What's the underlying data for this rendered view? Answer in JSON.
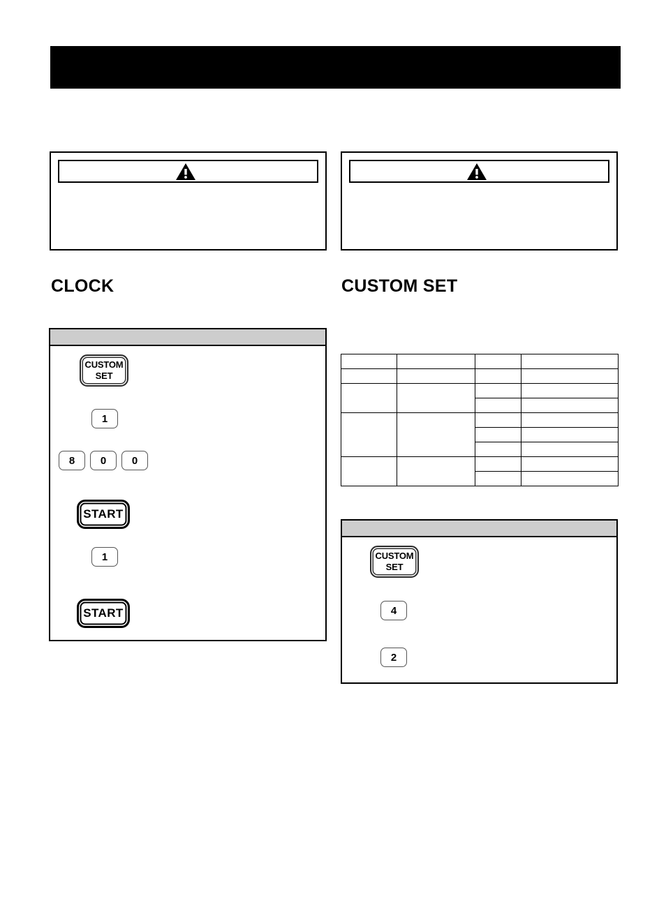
{
  "header": {
    "title": ""
  },
  "warnings": [
    {
      "id": "warning-left",
      "icon": "warning-triangle-icon",
      "label": "",
      "body": ""
    },
    {
      "id": "warning-right",
      "icon": "warning-triangle-icon",
      "label": "",
      "body": ""
    }
  ],
  "sections": {
    "clock": {
      "heading": "CLOCK",
      "panel": {
        "header": "",
        "steps": [
          {
            "keys": [
              {
                "type": "wide",
                "line1": "CUSTOM",
                "line2": "SET"
              }
            ],
            "text": ""
          },
          {
            "keys": [
              {
                "type": "digit",
                "label": "1"
              }
            ],
            "text": ""
          },
          {
            "keys": [
              {
                "type": "digit",
                "label": "8"
              },
              {
                "type": "digit",
                "label": "0"
              },
              {
                "type": "digit",
                "label": "0"
              }
            ],
            "text": ""
          },
          {
            "keys": [
              {
                "type": "start",
                "label": "START"
              }
            ],
            "text": ""
          },
          {
            "keys": [
              {
                "type": "digit",
                "label": "1"
              }
            ],
            "text": ""
          },
          {
            "keys": [
              {
                "type": "start",
                "label": "START"
              }
            ],
            "text": ""
          }
        ]
      }
    },
    "custom_set": {
      "heading": "CUSTOM SET",
      "table": {
        "columns": [
          "",
          "",
          "",
          ""
        ],
        "rows": [
          {
            "cells": [
              {
                "text": "",
                "rowspan": 1
              },
              {
                "text": "",
                "rowspan": 1
              },
              {
                "text": "",
                "rowspan": 1
              },
              {
                "text": "",
                "rowspan": 1
              }
            ]
          },
          {
            "cells": [
              {
                "text": "",
                "rowspan": 1
              },
              {
                "text": "",
                "rowspan": 1
              },
              {
                "text": "",
                "rowspan": 1
              },
              {
                "text": "",
                "rowspan": 1
              }
            ]
          },
          {
            "cells": [
              {
                "text": "",
                "rowspan": 2
              },
              {
                "text": "",
                "rowspan": 2
              },
              {
                "text": "",
                "rowspan": 1
              },
              {
                "text": "",
                "rowspan": 1
              }
            ]
          },
          {
            "cells": [
              {
                "text": "",
                "rowspan": 1
              },
              {
                "text": "",
                "rowspan": 1
              }
            ]
          },
          {
            "cells": [
              {
                "text": "",
                "rowspan": 3
              },
              {
                "text": "",
                "rowspan": 3
              },
              {
                "text": "",
                "rowspan": 1
              },
              {
                "text": "",
                "rowspan": 1
              }
            ]
          },
          {
            "cells": [
              {
                "text": "",
                "rowspan": 1
              },
              {
                "text": "",
                "rowspan": 1
              }
            ]
          },
          {
            "cells": [
              {
                "text": "",
                "rowspan": 1
              },
              {
                "text": "",
                "rowspan": 1
              }
            ]
          },
          {
            "cells": [
              {
                "text": "",
                "rowspan": 2
              },
              {
                "text": "",
                "rowspan": 2
              },
              {
                "text": "",
                "rowspan": 1
              },
              {
                "text": "",
                "rowspan": 1
              }
            ]
          },
          {
            "cells": [
              {
                "text": "",
                "rowspan": 1
              },
              {
                "text": "",
                "rowspan": 1
              }
            ]
          }
        ]
      },
      "panel": {
        "header": "",
        "steps": [
          {
            "keys": [
              {
                "type": "wide",
                "line1": "CUSTOM",
                "line2": "SET"
              }
            ],
            "text": ""
          },
          {
            "keys": [
              {
                "type": "digit",
                "label": "4"
              }
            ],
            "text": ""
          },
          {
            "keys": [
              {
                "type": "digit",
                "label": "2"
              }
            ],
            "text": ""
          }
        ]
      }
    }
  },
  "colors": {
    "header_bar": "#000000",
    "panel_header_gray": "#cdcdcd",
    "border": "#000000",
    "page_background": "#ffffff"
  }
}
